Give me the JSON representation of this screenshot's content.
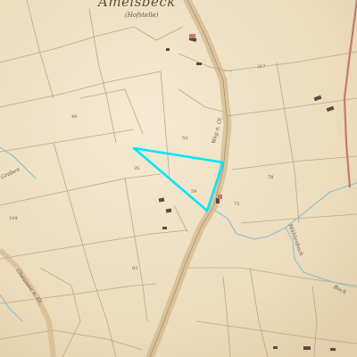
{
  "map": {
    "top_title": "Amelsbeck",
    "top_subtitle": "(Hofstelle)",
    "labels": [
      {
        "id": "road-label-upper",
        "text": "Weg n. Ol."
      },
      {
        "id": "road-label-left",
        "text": "Chaussee n. Ol."
      },
      {
        "id": "stream-label-right",
        "text": "Mühlenbach"
      },
      {
        "id": "stream-label-left",
        "text": "Graben"
      },
      {
        "id": "stream-label-bottom",
        "text": "Bach"
      }
    ],
    "parcel_numbers": [
      "217",
      "53",
      "59",
      "78",
      "93",
      "109",
      "48",
      "35",
      "72"
    ],
    "colors": {
      "paper": "#efe2c8",
      "road": "#c9a97a",
      "water": "#9cc2c8",
      "highlight": "#00e5ff",
      "boundary": "#b9a98a",
      "building": "#5a4a3c",
      "building_red": "#c87a6a"
    }
  }
}
